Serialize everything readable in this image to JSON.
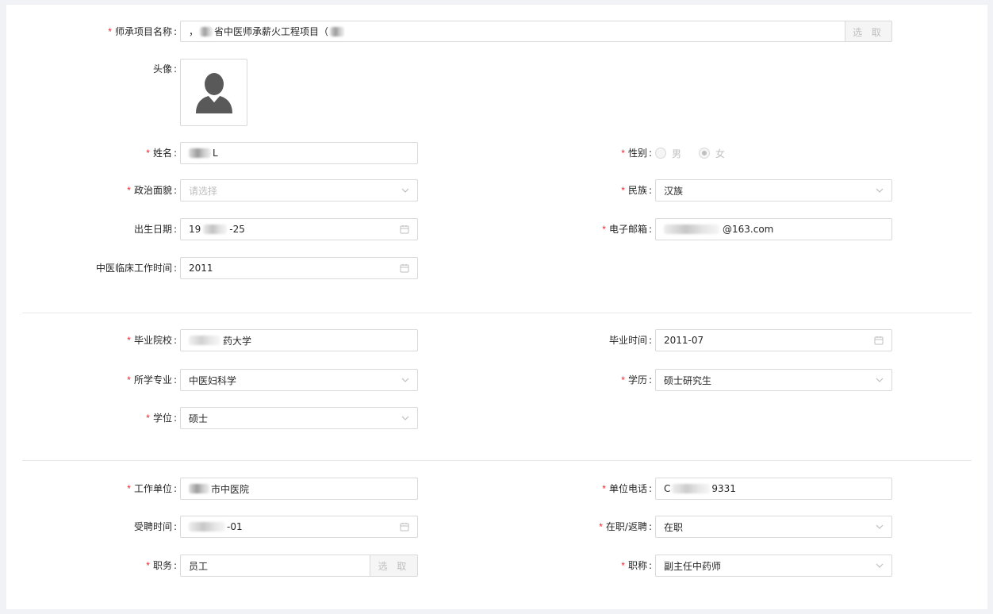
{
  "project": {
    "label": "师承项目名称",
    "value_prefix": "，",
    "value": "省中医师承薪火工程项目（",
    "select_button": "选 取"
  },
  "avatar": {
    "label": "头像",
    "icon": "user-avatar-icon"
  },
  "name": {
    "label": "姓名",
    "value_tail": "L"
  },
  "gender": {
    "label": "性别",
    "options": [
      "男",
      "女"
    ],
    "selected": "女"
  },
  "political": {
    "label": "政治面貌",
    "placeholder": "请选择"
  },
  "ethnicity": {
    "label": "民族",
    "value": "汉族"
  },
  "birth_date": {
    "label": "出生日期",
    "value_start": "19",
    "value_end": "-25"
  },
  "email": {
    "label": "电子邮箱",
    "value_suffix": "@163.com"
  },
  "clinical_time": {
    "label": "中医临床工作时间",
    "value": "2011"
  },
  "school": {
    "label": "毕业院校",
    "value_suffix": "药大学"
  },
  "grad_time": {
    "label": "毕业时间",
    "value": "2011-07"
  },
  "major": {
    "label": "所学专业",
    "value": "中医妇科学"
  },
  "education": {
    "label": "学历",
    "value": "硕士研究生"
  },
  "degree": {
    "label": "学位",
    "value": "硕士"
  },
  "employer": {
    "label": "工作单位",
    "value_suffix": "市中医院"
  },
  "phone": {
    "label": "单位电话",
    "value_start": "C",
    "value_end": "9331"
  },
  "hire_date": {
    "label": "受聘时间",
    "value_end": "-01"
  },
  "status": {
    "label": "在职/返聘",
    "value": "在职"
  },
  "position": {
    "label": "职务",
    "value": "员工",
    "select_button": "选 取"
  },
  "title": {
    "label": "职称",
    "value": "副主任中药师"
  },
  "colors": {
    "required": "#f5222d",
    "border": "#d9d9d9",
    "placeholder": "#bfbfbf",
    "page_bg": "#f0f2f5"
  }
}
